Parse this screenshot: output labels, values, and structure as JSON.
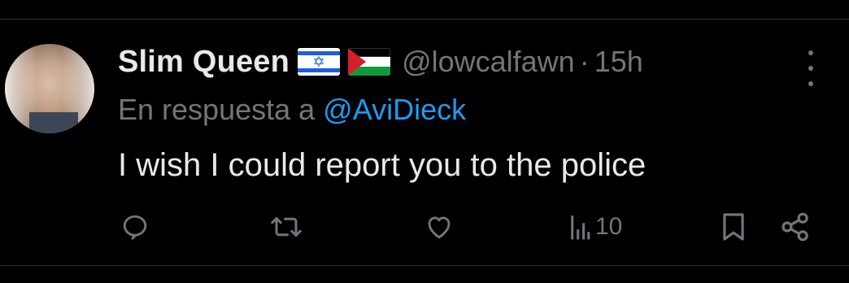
{
  "tweet": {
    "author": {
      "display_name": "Slim Queen",
      "flags": [
        "israel-flag",
        "palestine-flag"
      ],
      "handle": "@lowcalfawn"
    },
    "separator": "·",
    "time": "15h",
    "reply_prefix": "En respuesta a",
    "reply_to": "@AviDieck",
    "text": "I wish I could report you to the police",
    "actions": {
      "reply_icon": "reply-icon",
      "retweet_icon": "retweet-icon",
      "like_icon": "like-icon",
      "views_icon": "views-icon",
      "views_count": "10",
      "bookmark_icon": "bookmark-icon",
      "share_icon": "share-icon"
    },
    "more_icon": "more-options-icon"
  },
  "colors": {
    "background": "#000000",
    "text_primary": "#e7e9ea",
    "text_secondary": "#71767b",
    "link": "#1d9bf0",
    "divider": "#2f3336"
  }
}
